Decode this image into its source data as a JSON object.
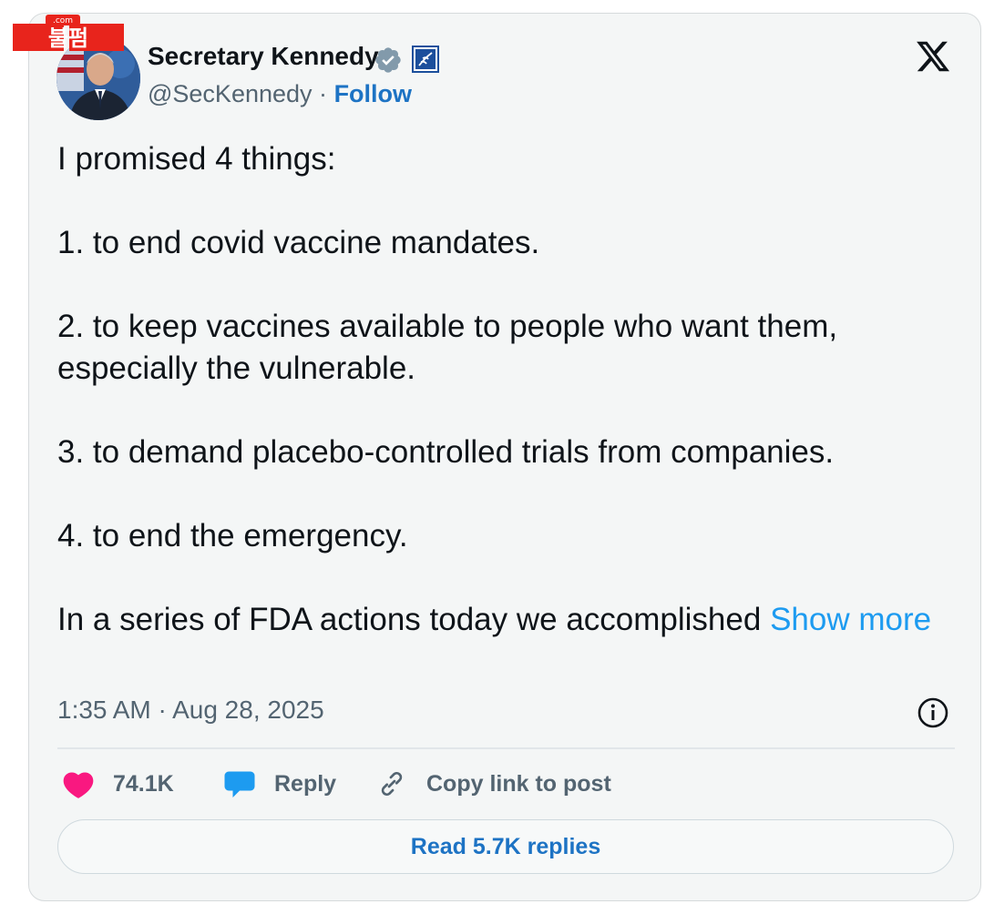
{
  "watermark": {
    "text": "불펌",
    "dot_com": ".com"
  },
  "author": {
    "name": "Secretary Kennedy",
    "handle": "@SecKennedy",
    "separator": "·",
    "follow_label": "Follow"
  },
  "post": {
    "paragraphs": [
      "I promised 4 things:",
      "1. to end covid vaccine mandates.",
      "2. to keep vaccines available to people who want them, especially the vulnerable.",
      "3. to demand placebo-controlled trials from companies.",
      "4. to end the emergency."
    ],
    "truncated_text": "In a series of FDA actions today we accomplished ",
    "show_more_label": "Show more",
    "timestamp": "1:35 AM · Aug 28, 2025"
  },
  "actions": {
    "likes_count": "74.1K",
    "reply_label": "Reply",
    "copy_link_label": "Copy link to post"
  },
  "read_replies_label": "Read 5.7K replies",
  "colors": {
    "like": "#f91880",
    "reply": "#1d9bf0",
    "link": "#1d73c4",
    "show_more": "#1d9bf0"
  },
  "icons": {
    "verified": "verified-badge-icon",
    "affiliate": "hhs-affiliate-icon",
    "platform": "x-logo-icon",
    "info": "info-icon",
    "like": "heart-icon",
    "reply": "speech-bubble-icon",
    "copy": "link-icon"
  }
}
